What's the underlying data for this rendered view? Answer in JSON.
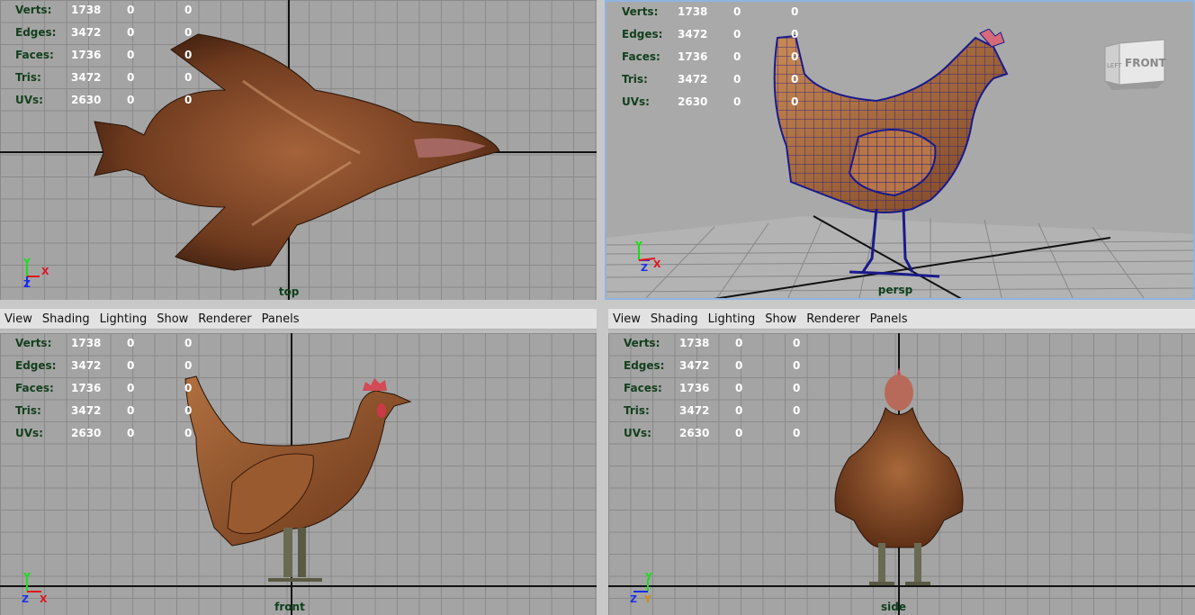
{
  "menu": [
    "View",
    "Shading",
    "Lighting",
    "Show",
    "Renderer",
    "Panels"
  ],
  "hud_labels": [
    "Verts:",
    "Edges:",
    "Faces:",
    "Tris:",
    "UVs:"
  ],
  "hud_values": [
    [
      "1738",
      "0",
      "0"
    ],
    [
      "3472",
      "0",
      "0"
    ],
    [
      "1736",
      "0",
      "0"
    ],
    [
      "3472",
      "0",
      "0"
    ],
    [
      "2630",
      "0",
      "0"
    ]
  ],
  "panels": {
    "top": {
      "camera": "top",
      "triad": [
        "Y",
        "X",
        "Z"
      ]
    },
    "persp": {
      "camera": "persp",
      "triad": [
        "Y",
        "Z",
        "X"
      ],
      "viewcube": [
        "LEFT",
        "FRONT"
      ]
    },
    "front": {
      "camera": "front",
      "triad": [
        "Y",
        "Z",
        "X"
      ]
    },
    "side": {
      "camera": "side",
      "triad": [
        "Y",
        "Z",
        "Y"
      ]
    }
  },
  "colors": {
    "axis_x": "#e0141e",
    "axis_y": "#16e016",
    "axis_z": "#1a2ee8",
    "hud_label": "#123f1c",
    "wireframe": "#1a1a8c",
    "active_border": "#8fb4e0"
  }
}
